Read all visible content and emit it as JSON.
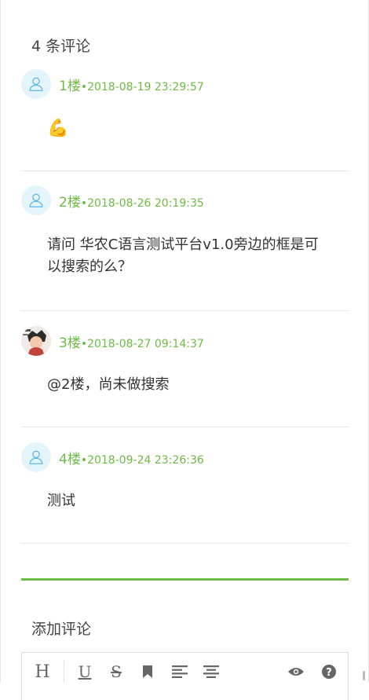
{
  "comments_section": {
    "count_title": "4 条评论",
    "comments": [
      {
        "floor": "1楼",
        "date": "•2018-08-19 23:29:57",
        "text": "💪",
        "avatar": "default-avatar"
      },
      {
        "floor": "2楼",
        "date": "•2018-08-26 20:19:35",
        "text": "请问 华农C语言测试平台v1.0旁边的框是可以搜索的么？",
        "avatar": "default-avatar"
      },
      {
        "floor": "3楼",
        "date": "•2018-08-27 09:14:37",
        "text": "@2楼，尚未做搜索",
        "avatar": "photo-avatar"
      },
      {
        "floor": "4楼",
        "date": "•2018-09-24 23:26:36",
        "text": "测试",
        "avatar": "default-avatar"
      }
    ]
  },
  "add_comment": {
    "title": "添加评论",
    "toolbar": [
      "heading-icon",
      "underline-icon",
      "strikethrough-icon",
      "bookmark-icon",
      "align-left-icon",
      "align-center-icon",
      "eye-icon",
      "help-icon"
    ]
  },
  "colors": {
    "accent": "#6dbb45",
    "avatar_bg": "#e3f4fb",
    "avatar_icon": "#5cb8e6"
  }
}
